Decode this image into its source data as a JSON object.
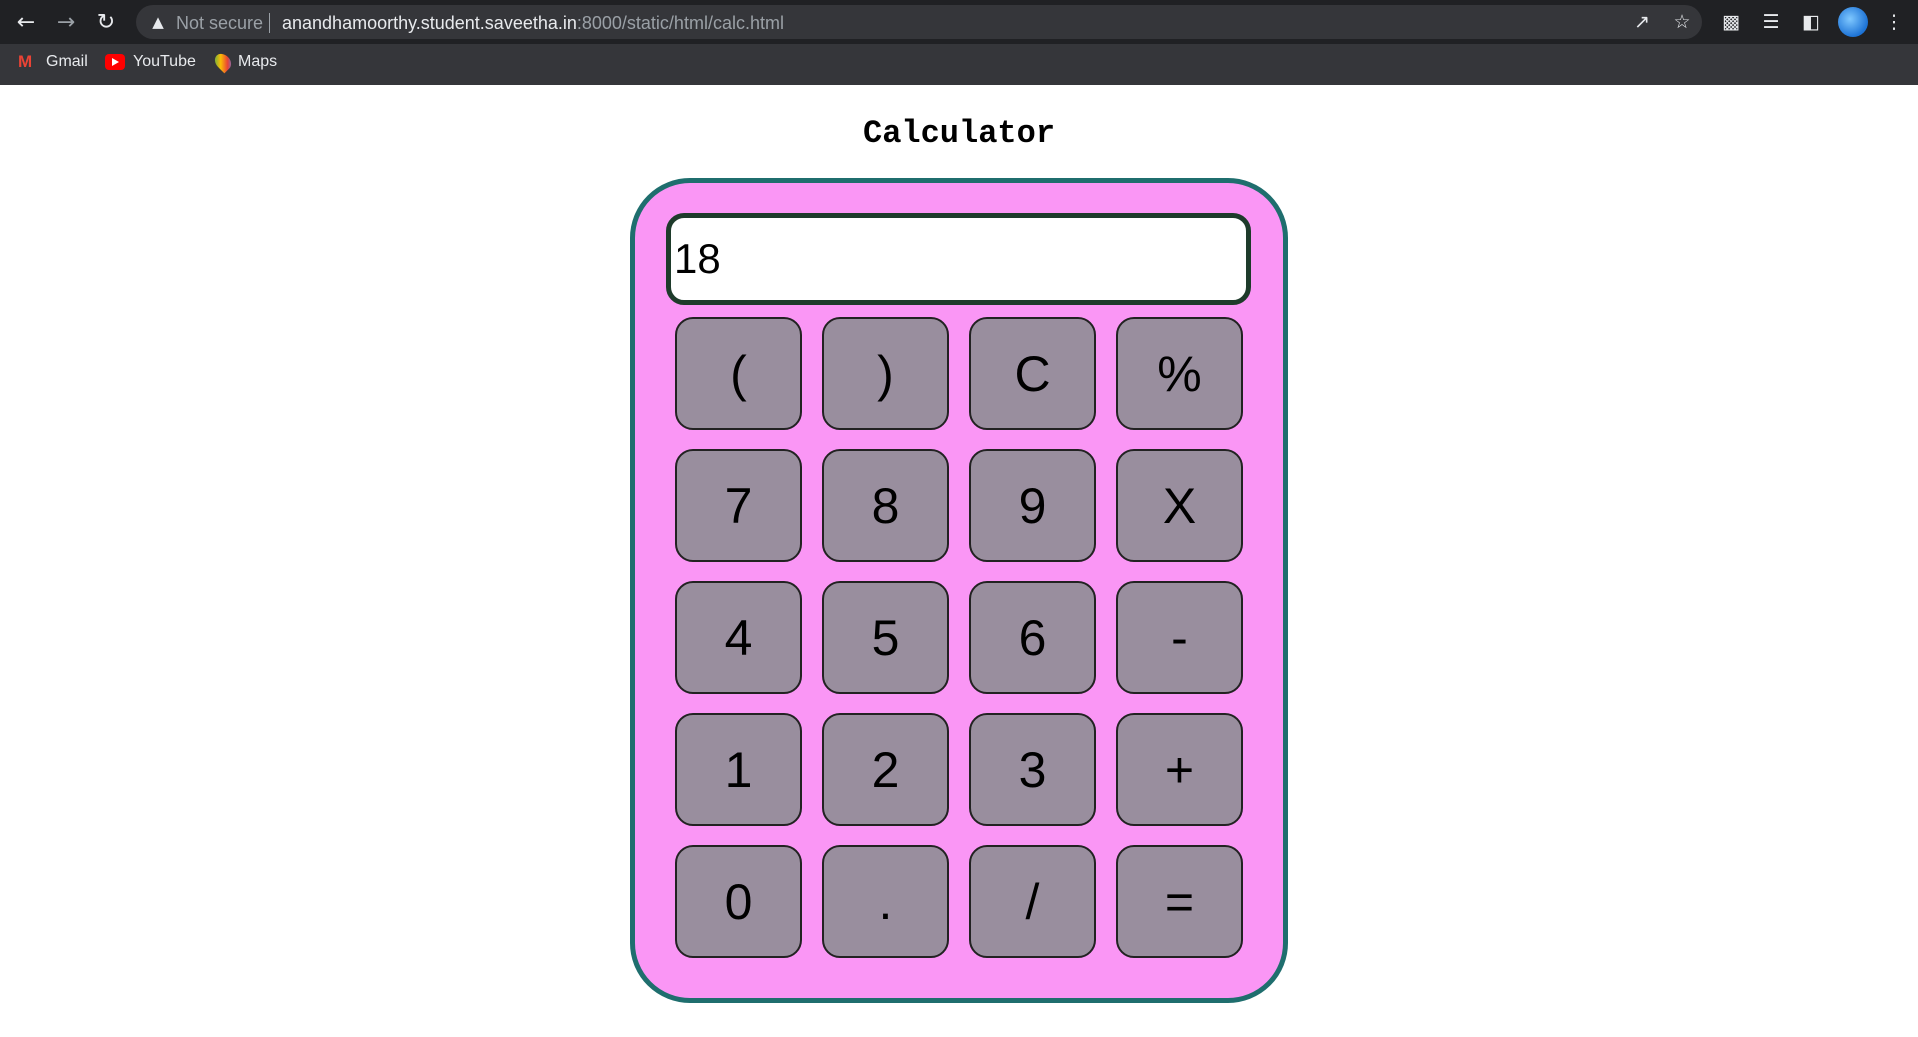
{
  "browser": {
    "security_label": "Not secure",
    "url_host": "anandhamoorthy.student.saveetha.in",
    "url_rest": ":8000/static/html/calc.html",
    "bookmarks": [
      {
        "label": "Gmail",
        "icon": "gmail-icon"
      },
      {
        "label": "YouTube",
        "icon": "youtube-icon"
      },
      {
        "label": "Maps",
        "icon": "maps-icon"
      }
    ]
  },
  "page": {
    "title": "Calculator"
  },
  "calculator": {
    "display_value": "18",
    "keys": [
      {
        "label": "(",
        "name": "key-open-paren"
      },
      {
        "label": ")",
        "name": "key-close-paren"
      },
      {
        "label": "C",
        "name": "key-clear"
      },
      {
        "label": "%",
        "name": "key-percent"
      },
      {
        "label": "7",
        "name": "key-7"
      },
      {
        "label": "8",
        "name": "key-8"
      },
      {
        "label": "9",
        "name": "key-9"
      },
      {
        "label": "X",
        "name": "key-multiply"
      },
      {
        "label": "4",
        "name": "key-4"
      },
      {
        "label": "5",
        "name": "key-5"
      },
      {
        "label": "6",
        "name": "key-6"
      },
      {
        "label": "-",
        "name": "key-minus"
      },
      {
        "label": "1",
        "name": "key-1"
      },
      {
        "label": "2",
        "name": "key-2"
      },
      {
        "label": "3",
        "name": "key-3"
      },
      {
        "label": "+",
        "name": "key-plus"
      },
      {
        "label": "0",
        "name": "key-0"
      },
      {
        "label": ".",
        "name": "key-decimal"
      },
      {
        "label": "/",
        "name": "key-divide"
      },
      {
        "label": "=",
        "name": "key-equals"
      }
    ]
  },
  "colors": {
    "calculator_body": "#fa96f5",
    "calculator_border": "#1f6e6e",
    "key_background": "#998e9e",
    "display_border": "#1e3b2b"
  }
}
